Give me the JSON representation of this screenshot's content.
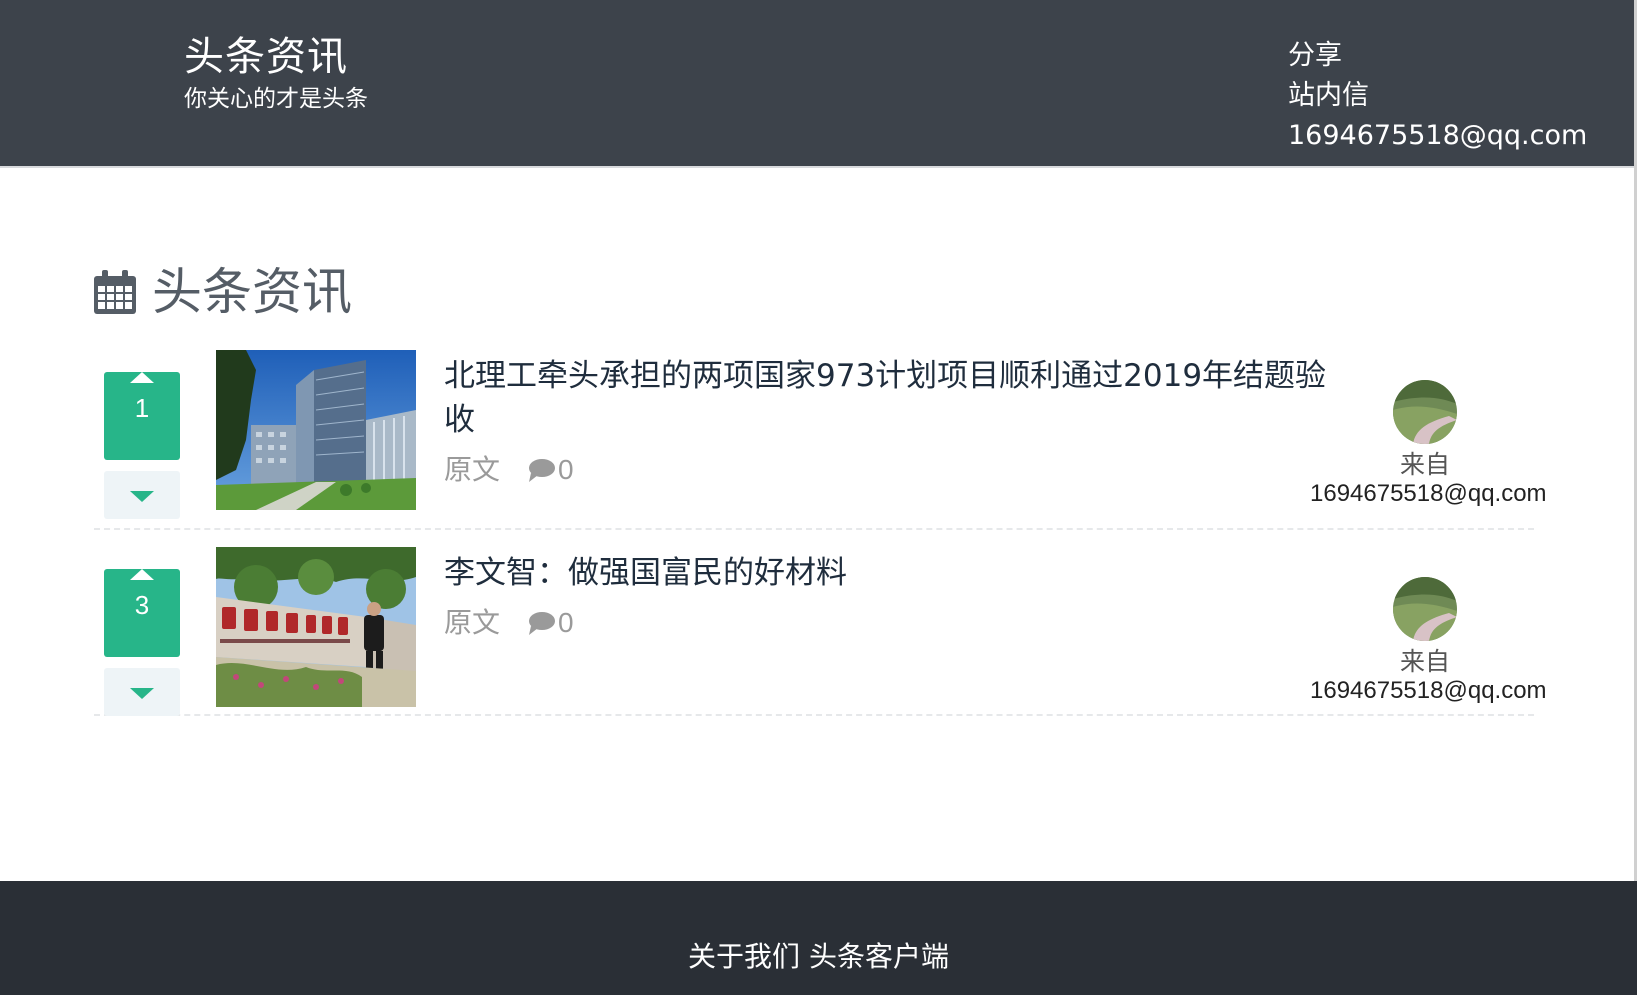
{
  "header": {
    "brand_title": "头条资讯",
    "brand_slogan": "你关心的才是头条",
    "nav": [
      "分享",
      "站内信",
      "1694675518@qq.com"
    ]
  },
  "section": {
    "title": "头条资讯",
    "icon": "calendar-icon"
  },
  "news": [
    {
      "votes": "1",
      "title": "北理工牵头承担的两项国家973计划项目顺利通过2019年结题验收",
      "source_label": "原文",
      "comment_count": "0",
      "author_from": "来自",
      "author_email": "1694675518@qq.com"
    },
    {
      "votes": "3",
      "title": "李文智：做强国富民的好材料",
      "source_label": "原文",
      "comment_count": "0",
      "author_from": "来自",
      "author_email": "1694675518@qq.com"
    }
  ],
  "footer": {
    "about": "关于我们",
    "client": "头条客户端"
  },
  "colors": {
    "header_bg": "#3d434b",
    "footer_bg": "#2a2f36",
    "accent": "#27b589",
    "vote_down_bg": "#eef4f7"
  }
}
